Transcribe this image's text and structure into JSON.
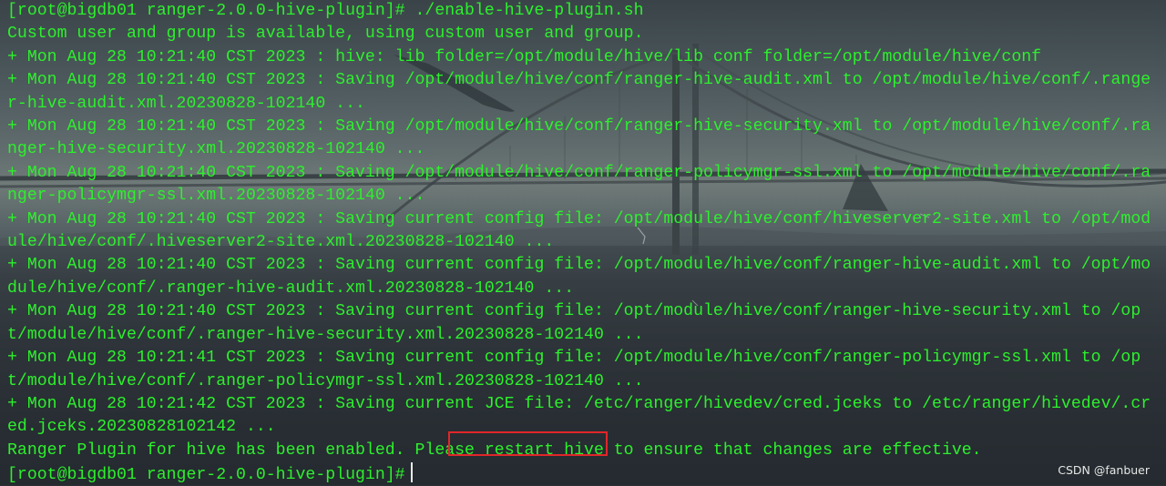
{
  "terminal": {
    "lines": [
      "[root@bigdb01 ranger-2.0.0-hive-plugin]# ./enable-hive-plugin.sh",
      "Custom user and group is available, using custom user and group.",
      "+ Mon Aug 28 10:21:40 CST 2023 : hive: lib folder=/opt/module/hive/lib conf folder=/opt/module/hive/conf",
      "+ Mon Aug 28 10:21:40 CST 2023 : Saving /opt/module/hive/conf/ranger-hive-audit.xml to /opt/module/hive/conf/.ranger-hive-audit.xml.20230828-102140 ...",
      "+ Mon Aug 28 10:21:40 CST 2023 : Saving /opt/module/hive/conf/ranger-hive-security.xml to /opt/module/hive/conf/.ranger-hive-security.xml.20230828-102140 ...",
      "+ Mon Aug 28 10:21:40 CST 2023 : Saving /opt/module/hive/conf/ranger-policymgr-ssl.xml to /opt/module/hive/conf/.ranger-policymgr-ssl.xml.20230828-102140 ...",
      "+ Mon Aug 28 10:21:40 CST 2023 : Saving current config file: /opt/module/hive/conf/hiveserver2-site.xml to /opt/module/hive/conf/.hiveserver2-site.xml.20230828-102140 ...",
      "+ Mon Aug 28 10:21:40 CST 2023 : Saving current config file: /opt/module/hive/conf/ranger-hive-audit.xml to /opt/module/hive/conf/.ranger-hive-audit.xml.20230828-102140 ...",
      "+ Mon Aug 28 10:21:40 CST 2023 : Saving current config file: /opt/module/hive/conf/ranger-hive-security.xml to /opt/module/hive/conf/.ranger-hive-security.xml.20230828-102140 ...",
      "+ Mon Aug 28 10:21:41 CST 2023 : Saving current config file: /opt/module/hive/conf/ranger-policymgr-ssl.xml to /opt/module/hive/conf/.ranger-policymgr-ssl.xml.20230828-102140 ...",
      "+ Mon Aug 28 10:21:42 CST 2023 : Saving current JCE file: /etc/ranger/hivedev/cred.jceks to /etc/ranger/hivedev/.cred.jceks.20230828102142 ...",
      "Ranger Plugin for hive has been enabled. Please restart hive to ensure that changes are effective."
    ],
    "prompt": "[root@bigdb01 ranger-2.0.0-hive-plugin]#"
  },
  "watermark": "CSDN @fanbuer",
  "colors": {
    "text": "#2df02d",
    "highlight_border": "#e0262a",
    "cursor": "#e8e8e8"
  }
}
